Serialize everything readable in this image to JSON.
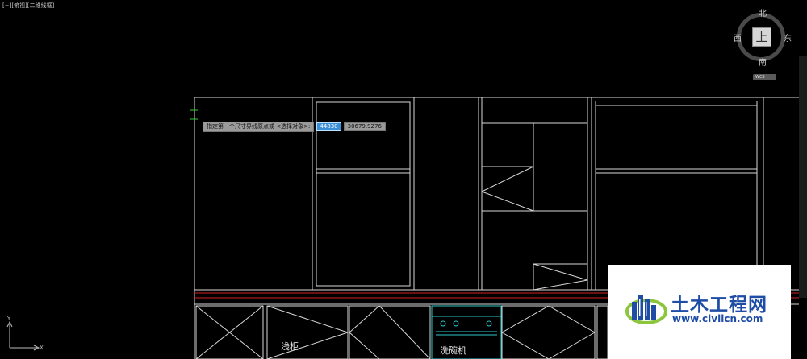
{
  "viewport": {
    "label": "[−][俯视][二维线框]"
  },
  "prompt": {
    "text": "指定第一个尺寸界线原点或 <选择对象>:",
    "x_value": "44830",
    "y_value": "30679.9276"
  },
  "viewcube": {
    "face": "上",
    "north": "北",
    "south": "南",
    "east": "东",
    "west": "西",
    "wcs_label": "WCS"
  },
  "labels": {
    "cabinet": "浅柜",
    "dishwasher": "洗碗机"
  },
  "watermark": {
    "title": "土木工程网",
    "url": "www.civilcn.com"
  },
  "colors": {
    "background": "#000000",
    "lines": "#d8d8d8",
    "red_line": "#d21f1f",
    "cyan": "#2cc7c7",
    "grip": "#2fcf2f",
    "input_highlight": "#3a8fd6",
    "brand_blue": "#1f4da6"
  }
}
